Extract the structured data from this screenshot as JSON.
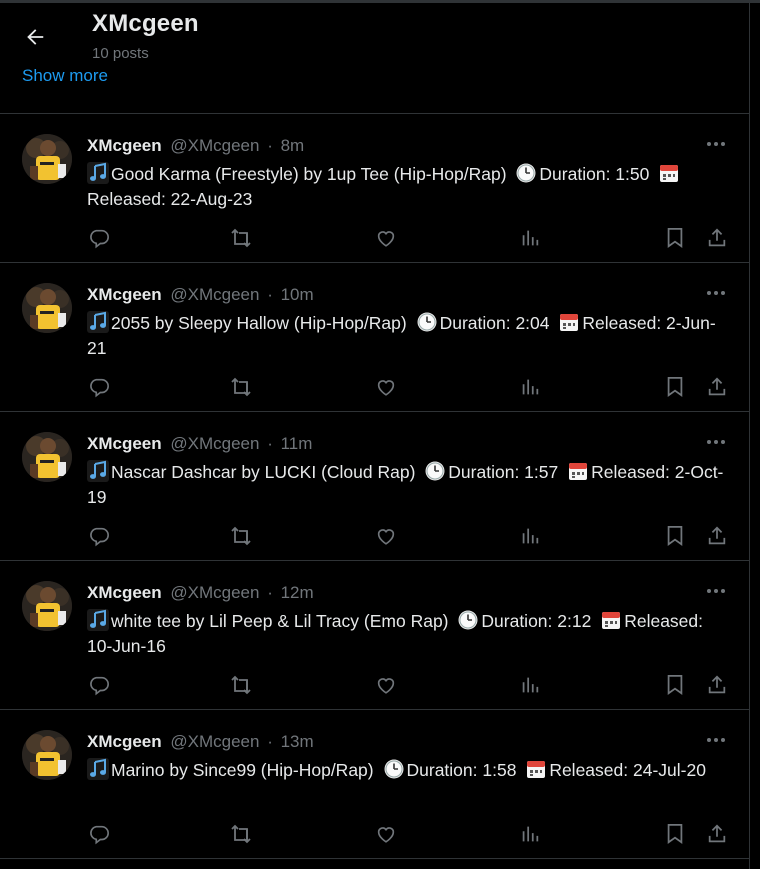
{
  "header": {
    "back_label": "Back",
    "profile_name": "XMcgeen",
    "post_count": "10 posts",
    "show_more": "Show more"
  },
  "colors": {
    "background": "#000000",
    "text": "#e7e9ea",
    "muted": "#71767b",
    "link": "#1d9bf0",
    "border": "#2f3336",
    "avatar_shirt": "#f2c230"
  },
  "icons": {
    "music_note": "musical-note-emoji",
    "clock": "clock-emoji",
    "calendar": "calendar-emoji"
  },
  "tweets": [
    {
      "name": "XMcgeen",
      "handle": "@XMcgeen",
      "dot": "·",
      "time": "8m",
      "title": "Good Karma (Freestyle) by 1up Tee (Hip-Hop/Rap)",
      "duration": "Duration: 1:50",
      "released": "Released: 22-Aug-23"
    },
    {
      "name": "XMcgeen",
      "handle": "@XMcgeen",
      "dot": "·",
      "time": "10m",
      "title": "2055 by Sleepy Hallow (Hip-Hop/Rap)",
      "duration": "Duration: 2:04",
      "released": "Released: 2-Jun-21"
    },
    {
      "name": "XMcgeen",
      "handle": "@XMcgeen",
      "dot": "·",
      "time": "11m",
      "title": "Nascar Dashcar by LUCKI (Cloud Rap)",
      "duration": "Duration: 1:57",
      "released": "Released: 2-Oct-19"
    },
    {
      "name": "XMcgeen",
      "handle": "@XMcgeen",
      "dot": "·",
      "time": "12m",
      "title": "white tee by Lil Peep & Lil Tracy (Emo Rap)",
      "duration": "Duration: 2:12",
      "released": "Released: 10-Jun-16"
    },
    {
      "name": "XMcgeen",
      "handle": "@XMcgeen",
      "dot": "·",
      "time": "13m",
      "title": "Marino by Since99 (Hip-Hop/Rap)",
      "duration": "Duration: 1:58",
      "released": "Released: 24-Jul-20"
    }
  ]
}
